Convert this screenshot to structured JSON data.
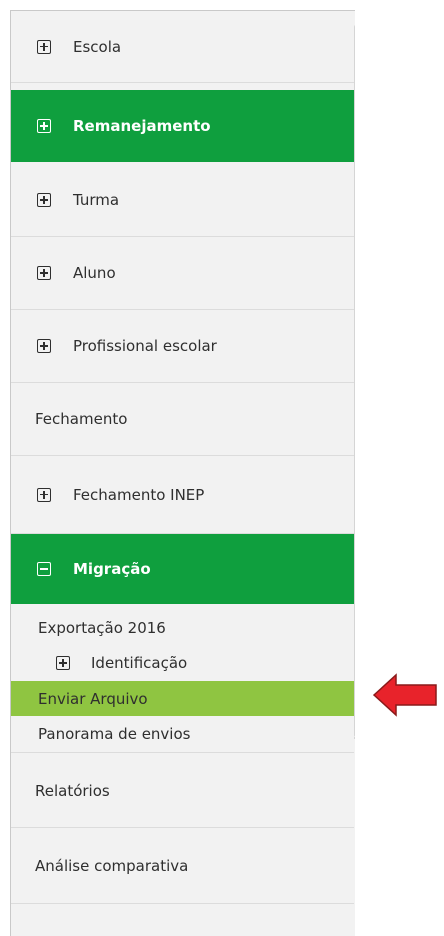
{
  "menu": {
    "escola": "Escola",
    "remanejamento": "Remanejamento",
    "turma": "Turma",
    "aluno": "Aluno",
    "profissional": "Profissional escolar",
    "fechamento": "Fechamento",
    "fechamento_inep": "Fechamento INEP",
    "migracao": "Migração",
    "relatorios": "Relatórios",
    "analise": "Análise comparativa"
  },
  "migracao_sub": {
    "exportacao": "Exportação 2016",
    "identificacao": "Identificação",
    "enviar": "Enviar Arquivo",
    "panorama": "Panorama de envios"
  },
  "colors": {
    "active_green": "#0f9f3e",
    "selected_light_green": "#8fc541",
    "arrow_red": "#e8232b"
  },
  "icons": {
    "expand": "plus-box-icon",
    "collapse": "minus-box-icon",
    "pointer": "red-arrow-icon"
  }
}
